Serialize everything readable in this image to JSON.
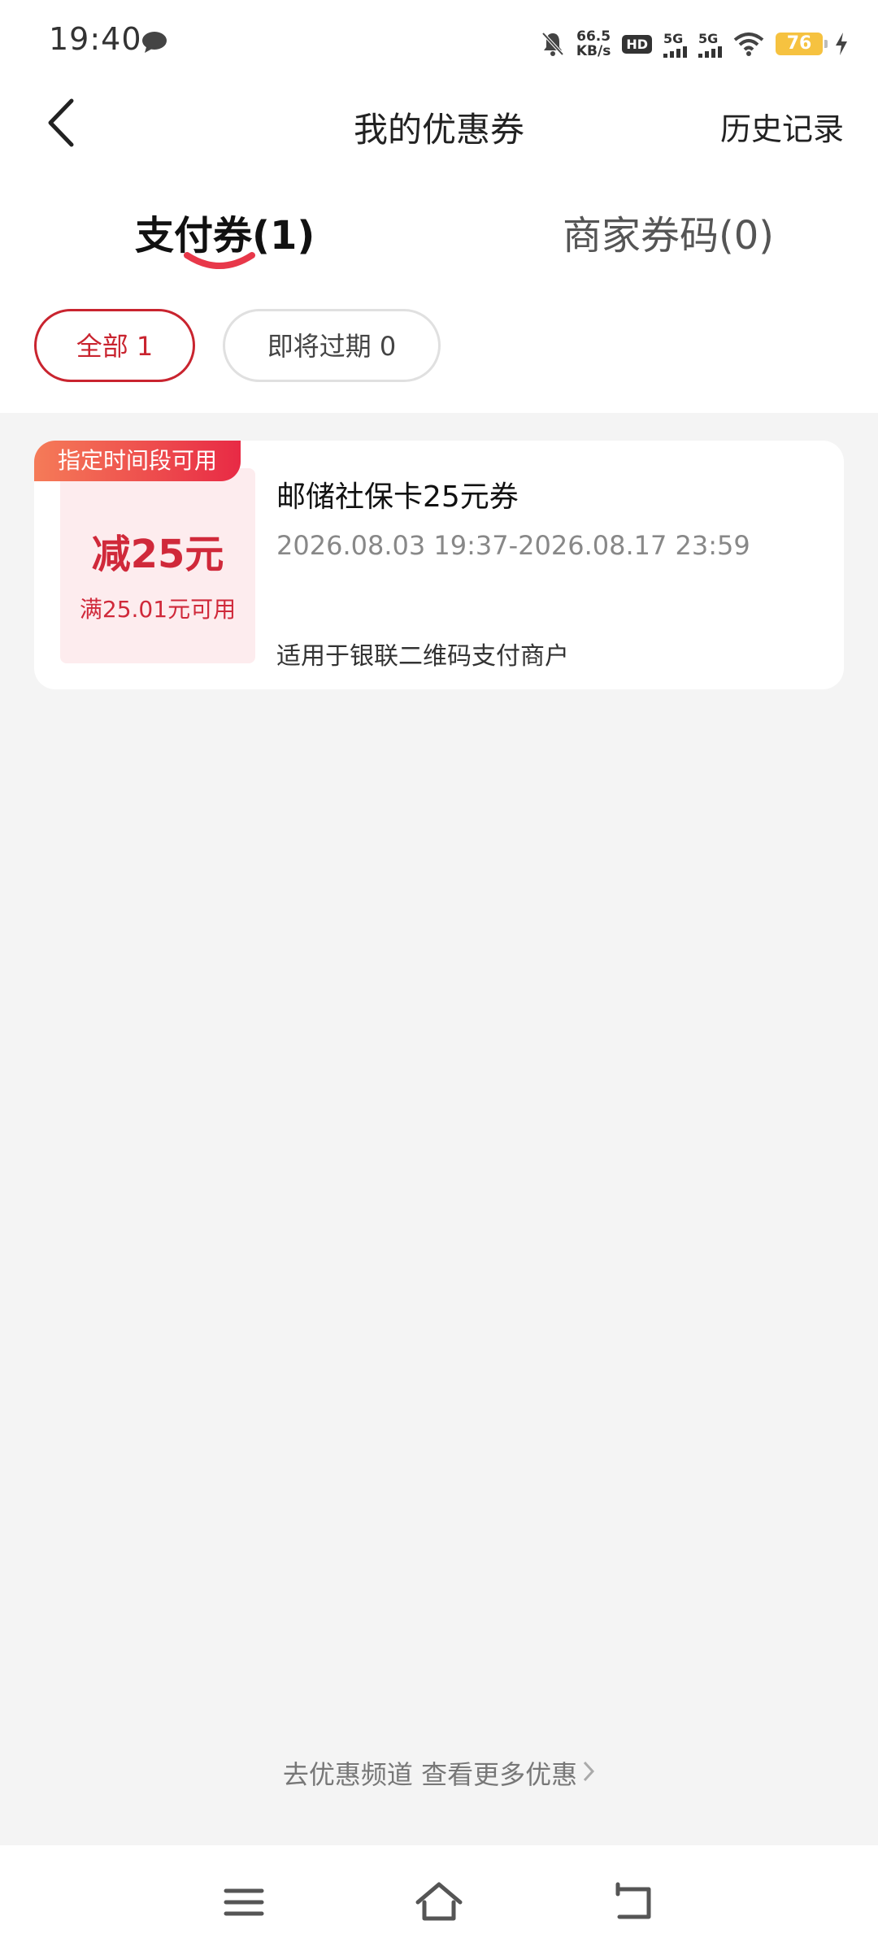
{
  "status_bar": {
    "time": "19:40",
    "net_speed_value": "66.5",
    "net_speed_unit": "KB/s",
    "hd_label": "HD",
    "sim1_label": "5G",
    "sim2_label": "5G",
    "battery": "76"
  },
  "header": {
    "title": "我的优惠券",
    "history_label": "历史记录"
  },
  "tabs": [
    {
      "label": "支付券(1)",
      "active": true
    },
    {
      "label": "商家券码(0)",
      "active": false
    }
  ],
  "filters": [
    {
      "label": "全部 1",
      "active": true
    },
    {
      "label": "即将过期 0",
      "active": false
    }
  ],
  "coupon": {
    "tag": "指定时间段可用",
    "amount": "减25元",
    "condition": "满25.01元可用",
    "name": "邮储社保卡25元券",
    "validity": "2026.08.03 19:37-2026.08.17 23:59",
    "scope": "适用于银联二维码支付商户"
  },
  "footer_link": "去优惠频道 查看更多优惠",
  "colors": {
    "accent": "#c9242f",
    "tag_gradient_start": "#f57b58",
    "tag_gradient_end": "#e82a45",
    "coupon_bg": "#fdecee",
    "page_bg": "#f4f4f4"
  },
  "icons": [
    "message-icon",
    "mute-bell-icon",
    "wifi-icon",
    "charging-icon",
    "back-arrow-icon",
    "menu-icon",
    "home-icon",
    "back-icon",
    "chevron-right-icon"
  ]
}
